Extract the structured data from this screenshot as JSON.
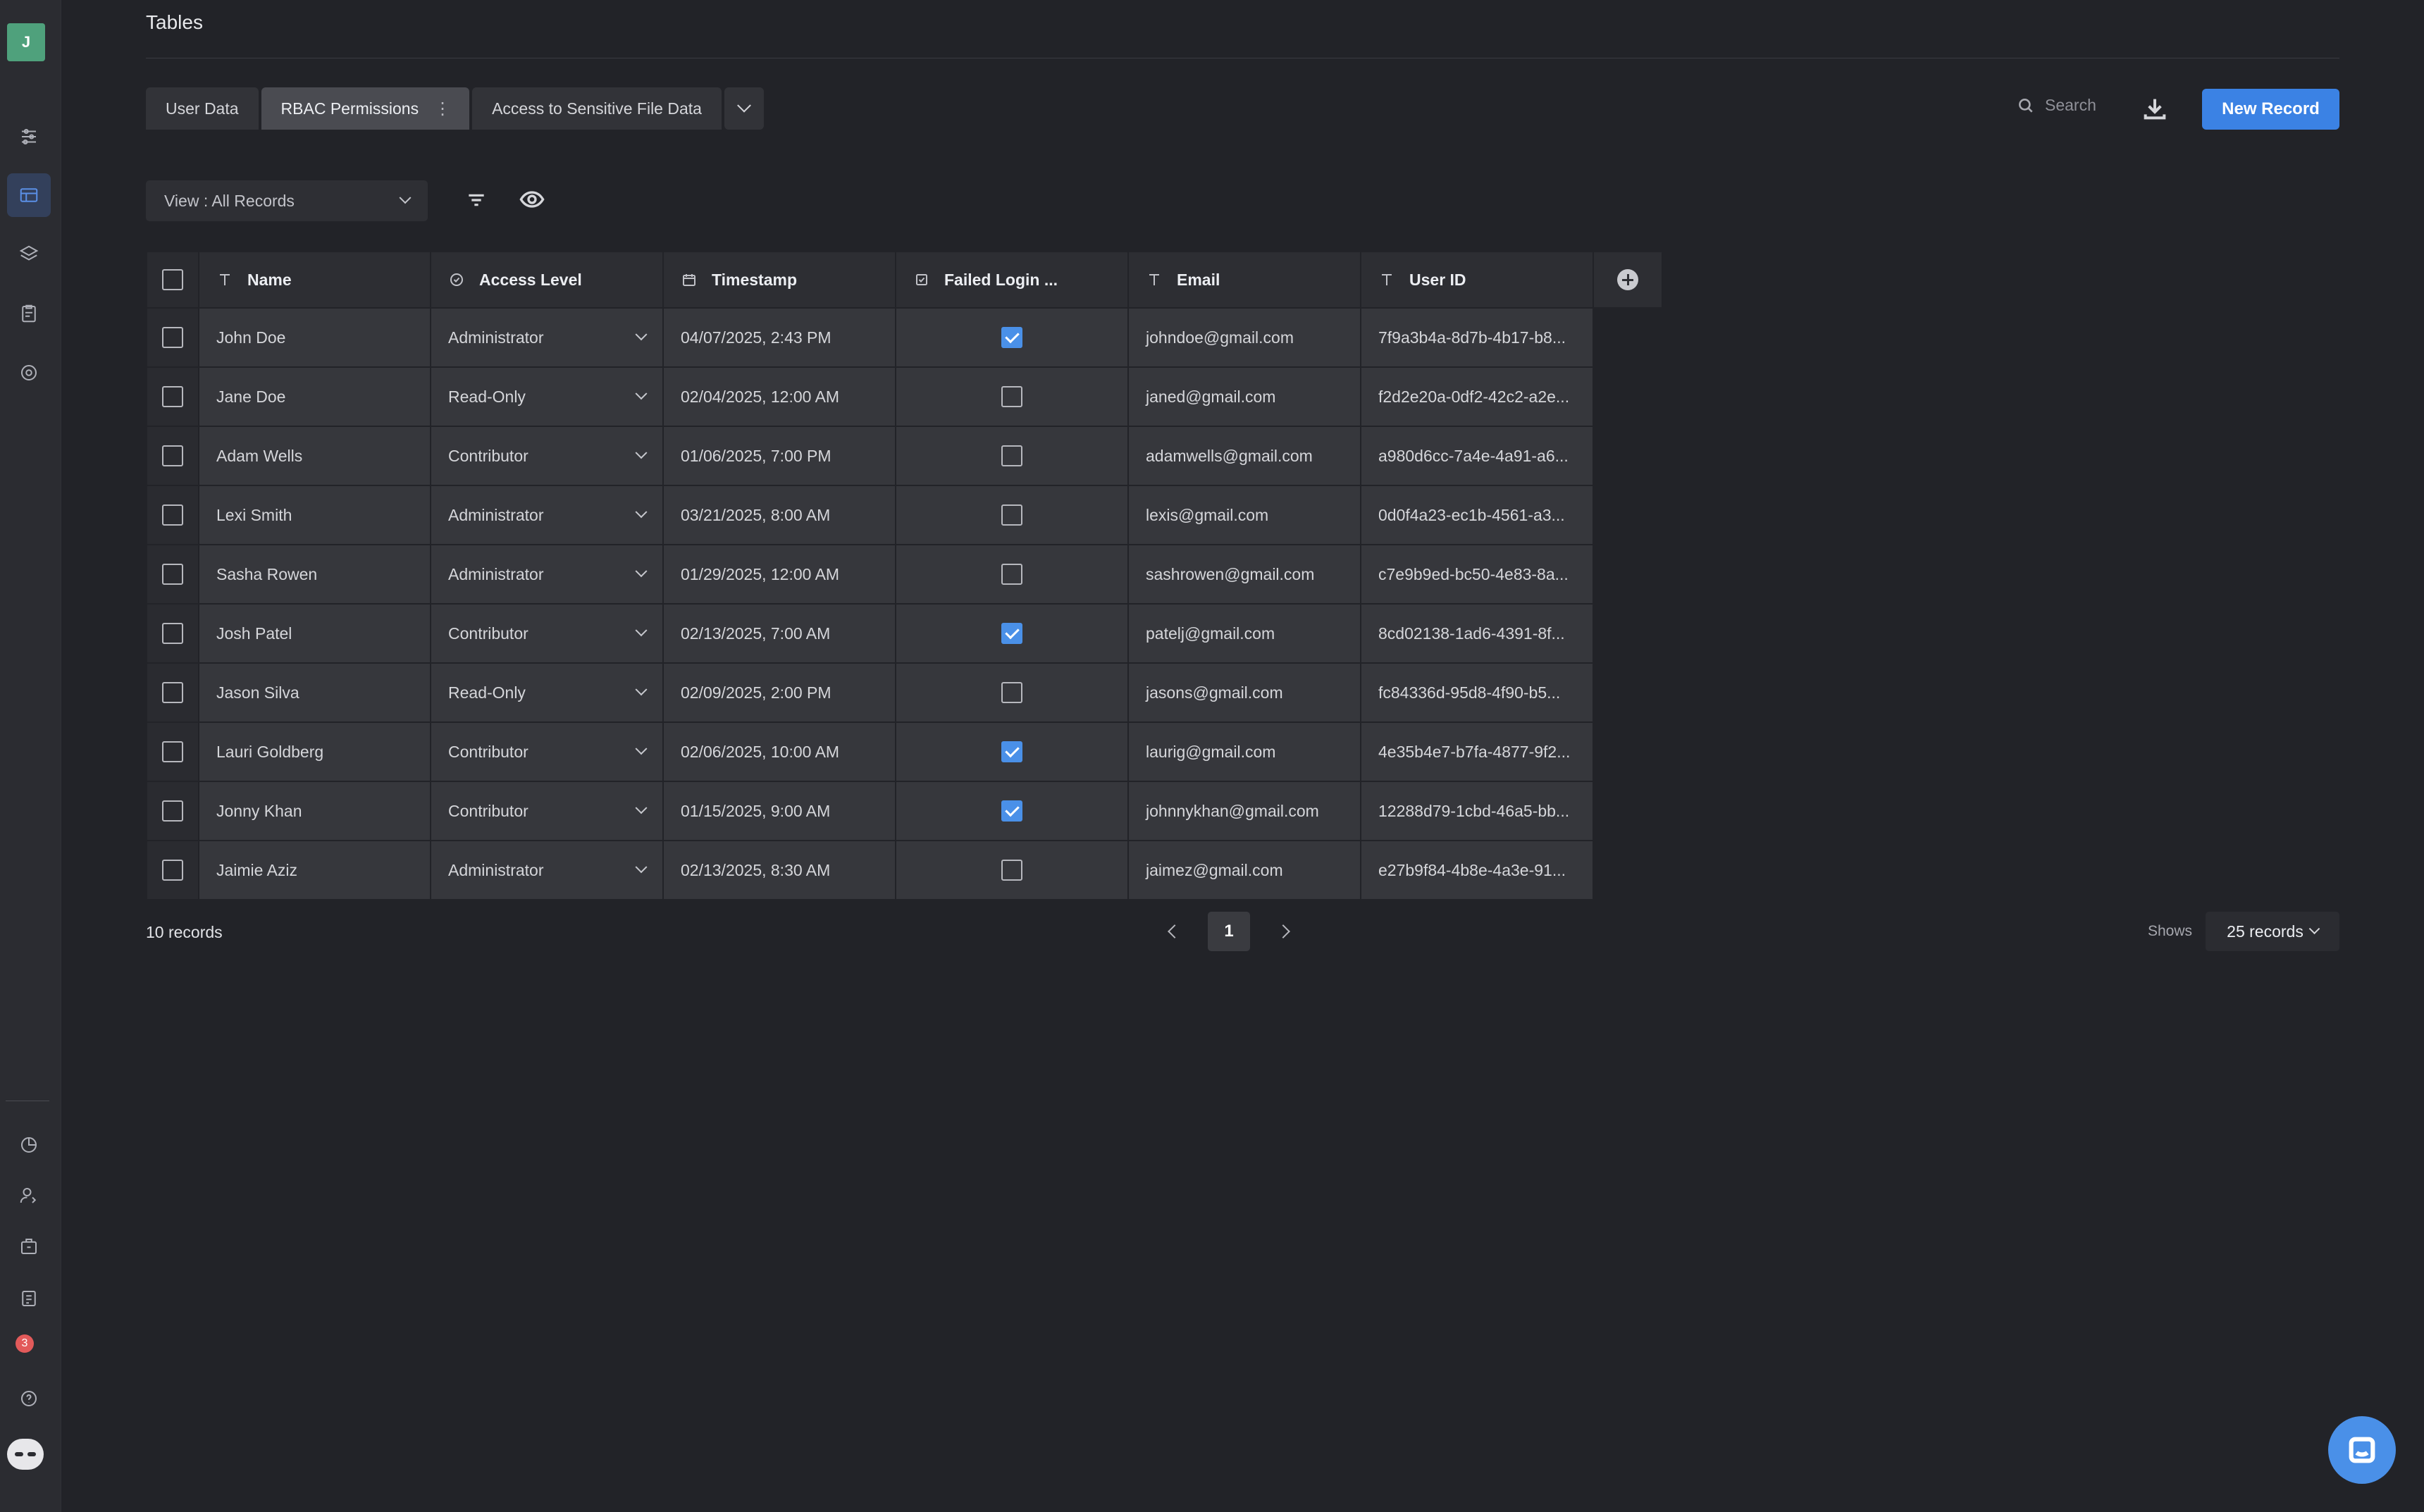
{
  "sidebar": {
    "avatar_initial": "J",
    "top_icons": [
      "sliders-icon",
      "table-icon",
      "layers-icon",
      "clipboard-icon",
      "target-icon"
    ],
    "bottom_icons": [
      "pie-chart-icon",
      "user-settings-icon",
      "briefcase-icon",
      "document-icon",
      "notification-icon",
      "help-icon",
      "bot-icon"
    ],
    "notification_count": "3"
  },
  "header": {
    "title": "Tables"
  },
  "tabs": [
    {
      "label": "User Data",
      "active": false
    },
    {
      "label": "RBAC Permissions",
      "active": true
    },
    {
      "label": "Access to Sensitive File Data",
      "active": false
    }
  ],
  "toolbar": {
    "search_placeholder": "Search",
    "new_record_label": "New Record",
    "view_label": "View : All Records"
  },
  "table": {
    "columns": [
      {
        "label": "Name",
        "icon": "text-icon"
      },
      {
        "label": "Access Level",
        "icon": "check-circle-icon"
      },
      {
        "label": "Timestamp",
        "icon": "calendar-icon"
      },
      {
        "label": "Failed Login ...",
        "icon": "checkbox-icon"
      },
      {
        "label": "Email",
        "icon": "text-icon"
      },
      {
        "label": "User ID",
        "icon": "text-icon"
      }
    ],
    "rows": [
      {
        "name": "John Doe",
        "access": "Administrator",
        "timestamp": "04/07/2025, 2:43 PM",
        "failed": true,
        "email": "johndoe@gmail.com",
        "user_id": "7f9a3b4a-8d7b-4b17-b8..."
      },
      {
        "name": "Jane Doe",
        "access": "Read-Only",
        "timestamp": "02/04/2025, 12:00 AM",
        "failed": false,
        "email": "janed@gmail.com",
        "user_id": "f2d2e20a-0df2-42c2-a2e..."
      },
      {
        "name": "Adam Wells",
        "access": "Contributor",
        "timestamp": "01/06/2025, 7:00 PM",
        "failed": false,
        "email": "adamwells@gmail.com",
        "user_id": "a980d6cc-7a4e-4a91-a6..."
      },
      {
        "name": "Lexi Smith",
        "access": "Administrator",
        "timestamp": "03/21/2025, 8:00 AM",
        "failed": false,
        "email": "lexis@gmail.com",
        "user_id": "0d0f4a23-ec1b-4561-a3..."
      },
      {
        "name": "Sasha Rowen",
        "access": "Administrator",
        "timestamp": "01/29/2025, 12:00 AM",
        "failed": false,
        "email": "sashrowen@gmail.com",
        "user_id": "c7e9b9ed-bc50-4e83-8a..."
      },
      {
        "name": "Josh Patel",
        "access": "Contributor",
        "timestamp": "02/13/2025, 7:00 AM",
        "failed": true,
        "email": "patelj@gmail.com",
        "user_id": "8cd02138-1ad6-4391-8f..."
      },
      {
        "name": "Jason Silva",
        "access": "Read-Only",
        "timestamp": "02/09/2025, 2:00 PM",
        "failed": false,
        "email": "jasons@gmail.com",
        "user_id": "fc84336d-95d8-4f90-b5..."
      },
      {
        "name": "Lauri Goldberg",
        "access": "Contributor",
        "timestamp": "02/06/2025, 10:00 AM",
        "failed": true,
        "email": "laurig@gmail.com",
        "user_id": "4e35b4e7-b7fa-4877-9f2..."
      },
      {
        "name": "Jonny Khan",
        "access": "Contributor",
        "timestamp": "01/15/2025, 9:00 AM",
        "failed": true,
        "email": "johnnykhan@gmail.com",
        "user_id": "12288d79-1cbd-46a5-bb..."
      },
      {
        "name": "Jaimie Aziz",
        "access": "Administrator",
        "timestamp": "02/13/2025, 8:30 AM",
        "failed": false,
        "email": "jaimez@gmail.com",
        "user_id": "e27b9f84-4b8e-4a3e-91..."
      }
    ]
  },
  "footer": {
    "record_count": "10 records",
    "current_page": "1",
    "shows_label": "Shows",
    "per_page": "25 records"
  },
  "colors": {
    "accent": "#3b82e4",
    "background": "#222328",
    "avatar": "#4fa17c"
  }
}
